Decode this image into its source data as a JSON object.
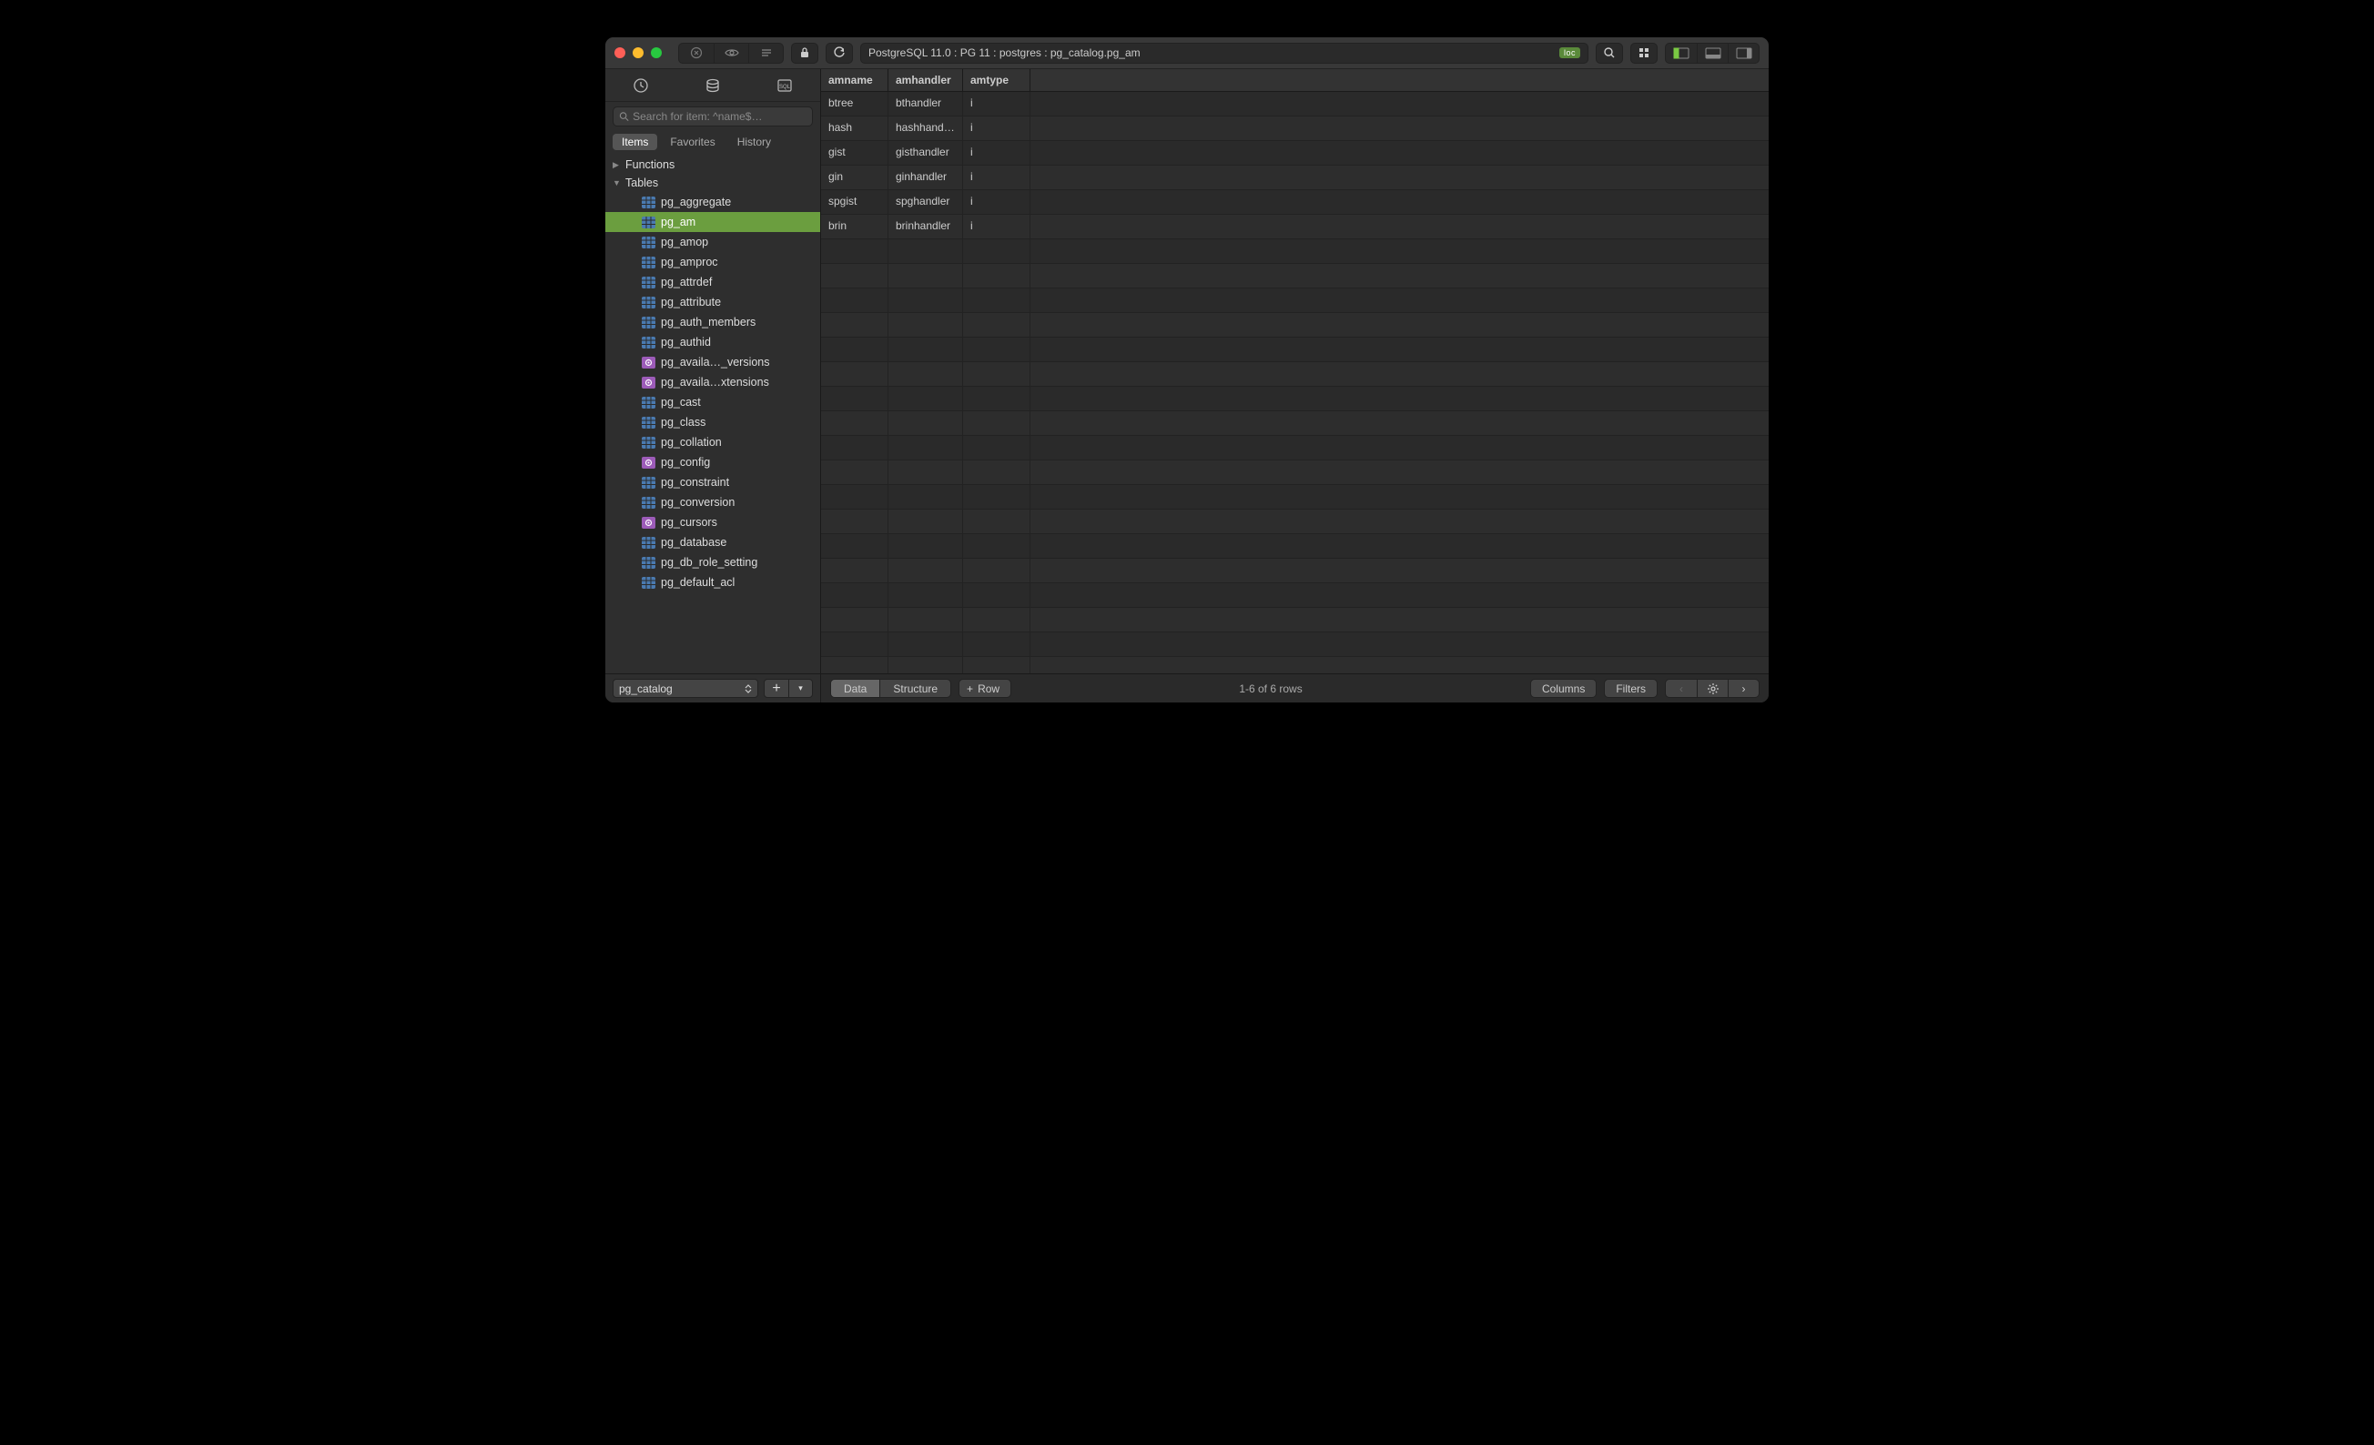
{
  "titlebar": {
    "breadcrumb": "PostgreSQL 11.0 : PG 11 : postgres : pg_catalog.pg_am",
    "loc_badge": "loc"
  },
  "sidebar": {
    "search_placeholder": "Search for item: ^name$…",
    "tabs": {
      "items": "Items",
      "favorites": "Favorites",
      "history": "History"
    },
    "groups": {
      "functions": "Functions",
      "tables": "Tables"
    },
    "tables": [
      {
        "label": "pg_aggregate",
        "type": "table"
      },
      {
        "label": "pg_am",
        "type": "table",
        "selected": true
      },
      {
        "label": "pg_amop",
        "type": "table"
      },
      {
        "label": "pg_amproc",
        "type": "table"
      },
      {
        "label": "pg_attrdef",
        "type": "table"
      },
      {
        "label": "pg_attribute",
        "type": "table"
      },
      {
        "label": "pg_auth_members",
        "type": "table"
      },
      {
        "label": "pg_authid",
        "type": "table"
      },
      {
        "label": "pg_availa…_versions",
        "type": "view"
      },
      {
        "label": "pg_availa…xtensions",
        "type": "view"
      },
      {
        "label": "pg_cast",
        "type": "table"
      },
      {
        "label": "pg_class",
        "type": "table"
      },
      {
        "label": "pg_collation",
        "type": "table"
      },
      {
        "label": "pg_config",
        "type": "view"
      },
      {
        "label": "pg_constraint",
        "type": "table"
      },
      {
        "label": "pg_conversion",
        "type": "table"
      },
      {
        "label": "pg_cursors",
        "type": "view"
      },
      {
        "label": "pg_database",
        "type": "table"
      },
      {
        "label": "pg_db_role_setting",
        "type": "table"
      },
      {
        "label": "pg_default_acl",
        "type": "table"
      }
    ],
    "schema": "pg_catalog"
  },
  "grid": {
    "columns": [
      "amname",
      "amhandler",
      "amtype"
    ],
    "rows": [
      {
        "amname": "btree",
        "amhandler": "bthandler",
        "amtype": "i"
      },
      {
        "amname": "hash",
        "amhandler": "hashhandler",
        "amtype": "i"
      },
      {
        "amname": "gist",
        "amhandler": "gisthandler",
        "amtype": "i"
      },
      {
        "amname": "gin",
        "amhandler": "ginhandler",
        "amtype": "i"
      },
      {
        "amname": "spgist",
        "amhandler": "spghandler",
        "amtype": "i"
      },
      {
        "amname": "brin",
        "amhandler": "brinhandler",
        "amtype": "i"
      }
    ]
  },
  "footer": {
    "data": "Data",
    "structure": "Structure",
    "row": "Row",
    "status": "1-6 of 6 rows",
    "columns": "Columns",
    "filters": "Filters"
  }
}
